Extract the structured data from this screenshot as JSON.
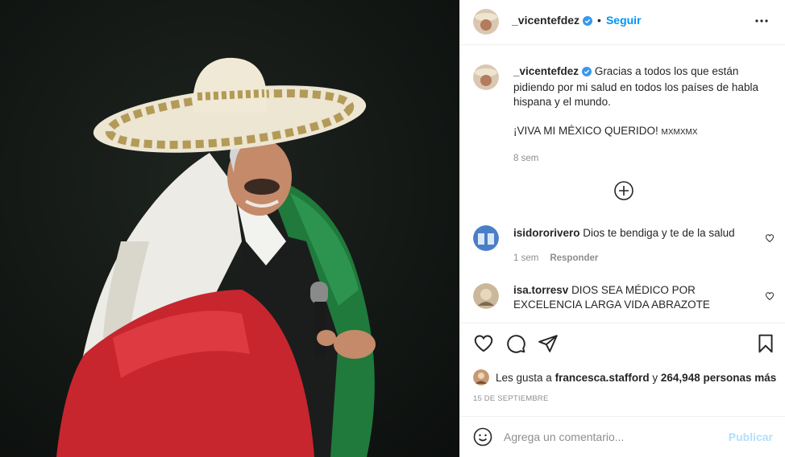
{
  "post": {
    "username": "_vicentefdez",
    "verified": true,
    "follow_label": "Seguir",
    "follow_dot": "•",
    "more_icon": "more-horizontal-icon"
  },
  "caption": {
    "username": "_vicentefdez",
    "text": "Gracias a todos los que están pidiendo por mi salud en todos los países de habla hispana y el mundo.",
    "text2": "¡VIVA MI MÉXICO QUERIDO!",
    "text2_suffix": "MXMXMX",
    "time": "8 sem"
  },
  "load_more_icon": "plus-circle-icon",
  "comments": [
    {
      "username": "isidororivero",
      "text": "Dios te bendiga y te de la salud",
      "time": "1 sem",
      "reply_label": "Responder"
    },
    {
      "username": "isa.torresv",
      "text": "DIOS SEA MÉDICO POR EXCELENCIA LARGA VIDA ABRAZOTE"
    }
  ],
  "likes": {
    "prefix": "Les gusta a",
    "user": "francesca.stafford",
    "conj": "y",
    "count": "264,948 personas más"
  },
  "date": "15 DE SEPTIEMBRE",
  "comment_box": {
    "placeholder": "Agrega un comentario...",
    "publish_label": "Publicar"
  },
  "colors": {
    "accent": "#0095f6",
    "publish_disabled": "#b2dffc",
    "muted": "#8e8e8e"
  }
}
